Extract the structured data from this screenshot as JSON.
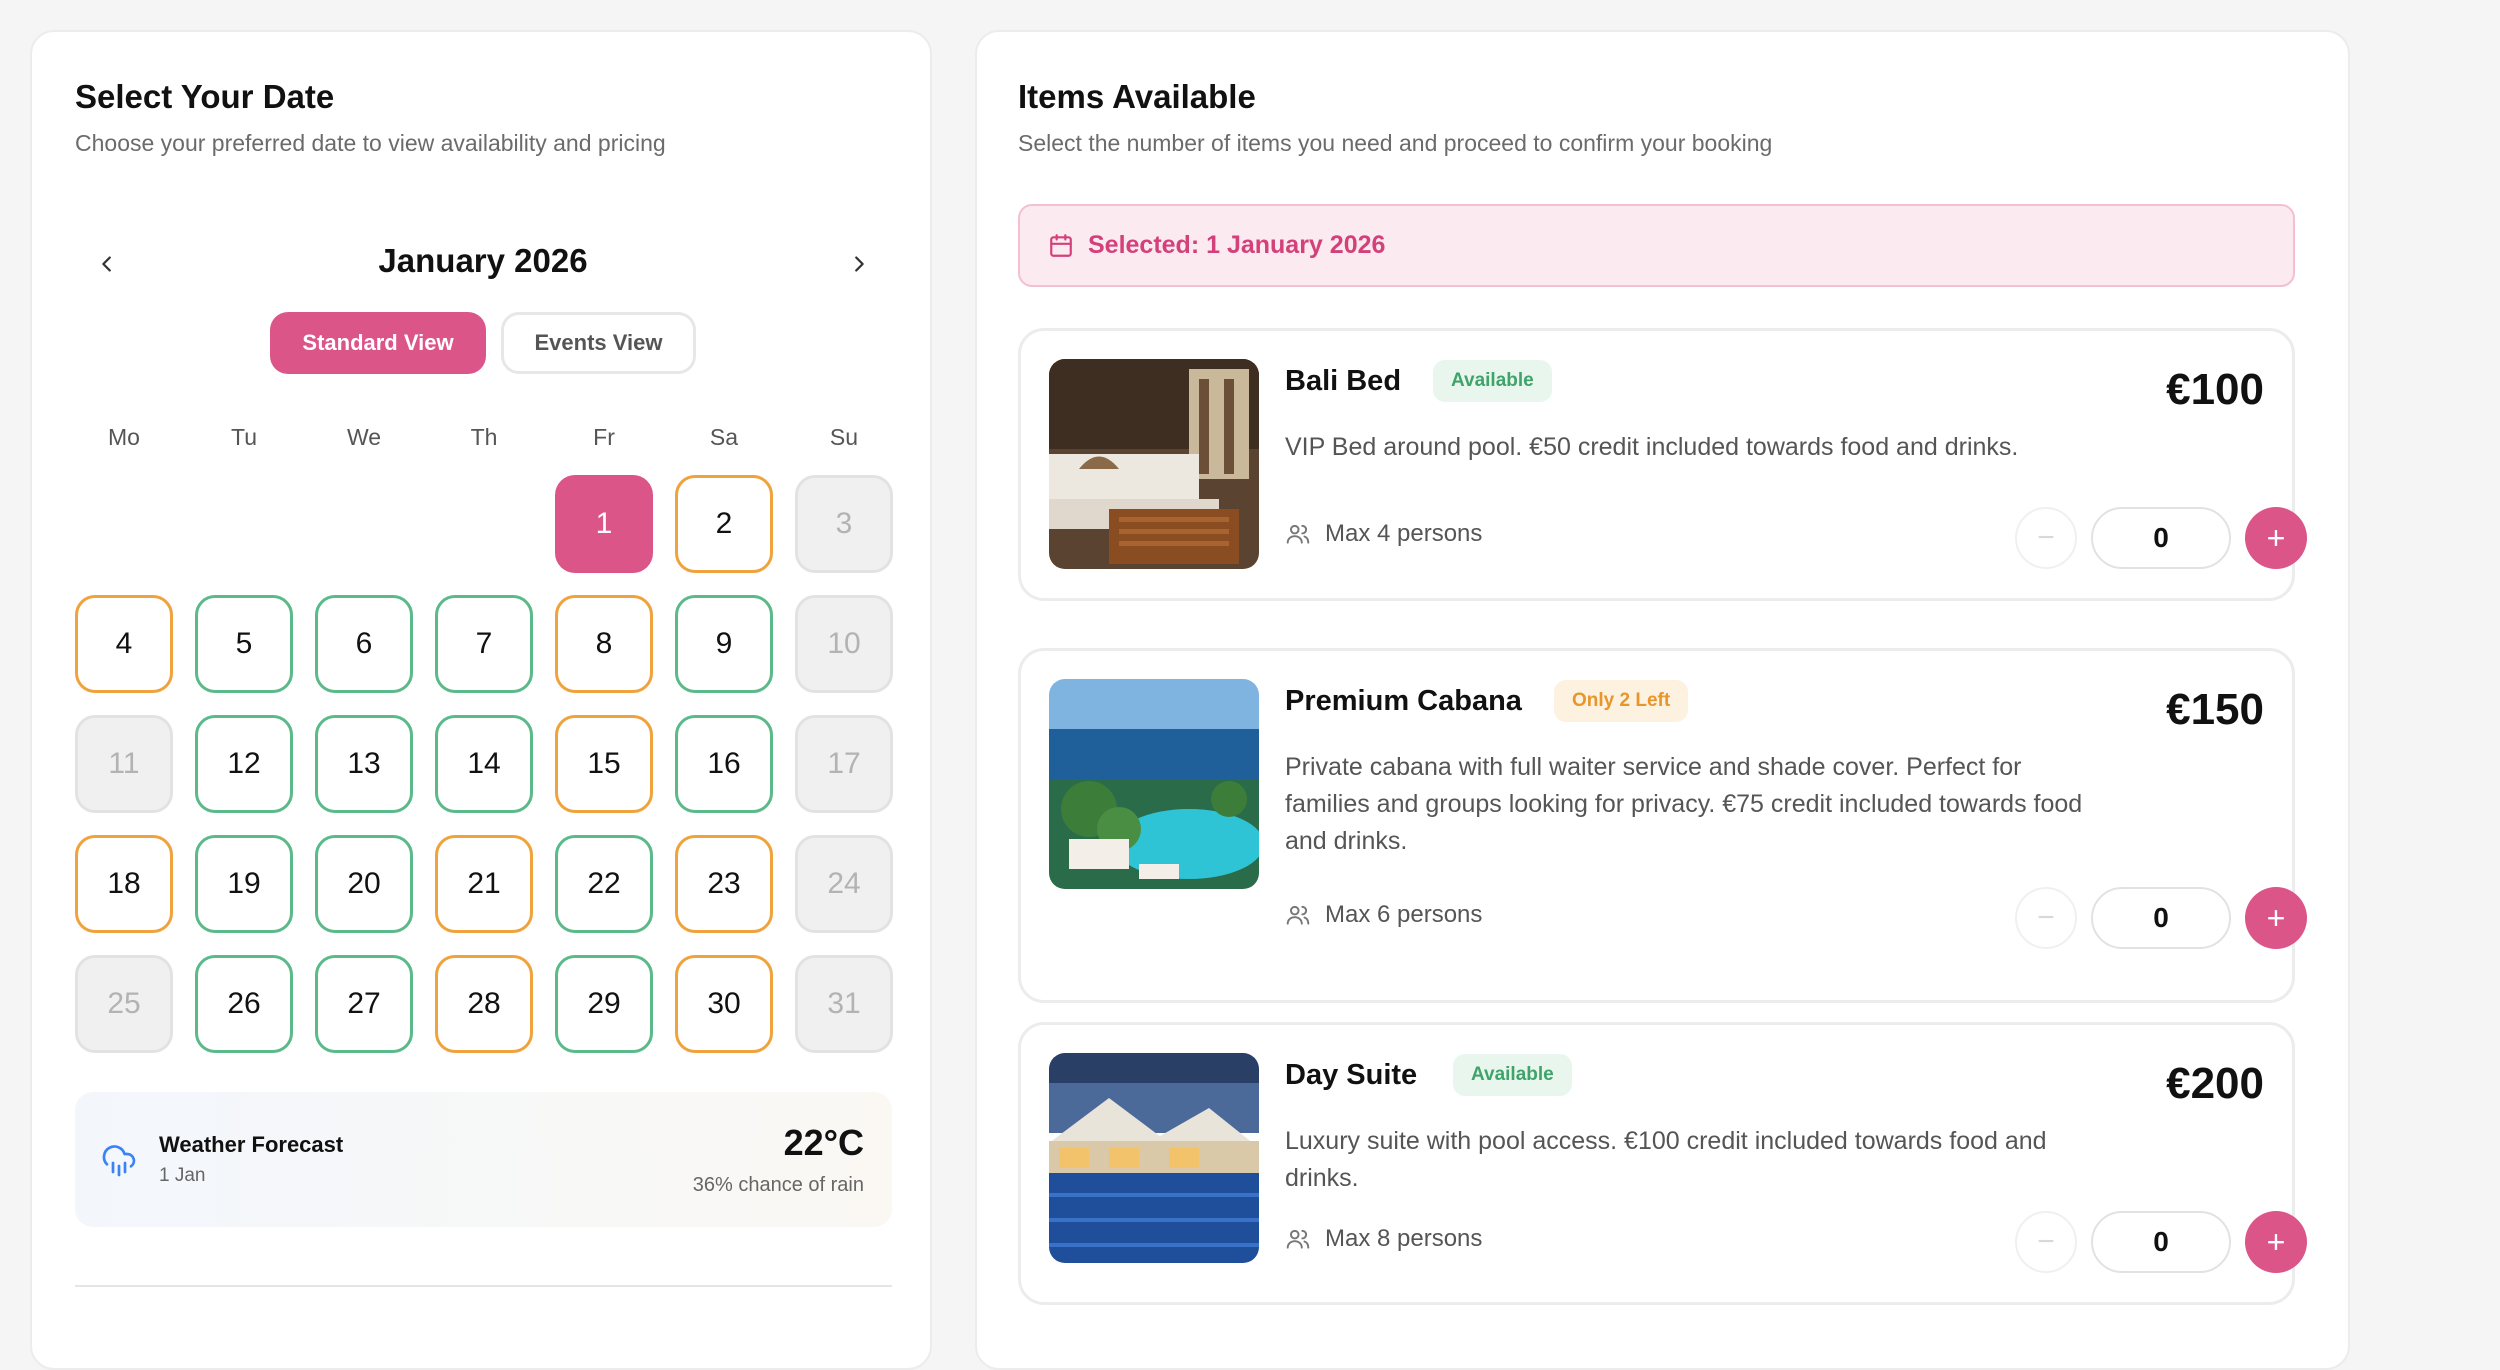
{
  "date_panel": {
    "title": "Select Your Date",
    "subtitle": "Choose your preferred date to view availability and pricing",
    "month_label": "January 2026",
    "view_toggle": {
      "standard": "Standard View",
      "events": "Events View",
      "active": "standard"
    },
    "weekdays": [
      "Mo",
      "Tu",
      "We",
      "Th",
      "Fr",
      "Sa",
      "Su"
    ],
    "days": [
      {
        "day": "1",
        "status": "selected"
      },
      {
        "day": "2",
        "status": "limited"
      },
      {
        "day": "3",
        "status": "unavailable"
      },
      {
        "day": "4",
        "status": "limited"
      },
      {
        "day": "5",
        "status": "available"
      },
      {
        "day": "6",
        "status": "available"
      },
      {
        "day": "7",
        "status": "available"
      },
      {
        "day": "8",
        "status": "limited"
      },
      {
        "day": "9",
        "status": "available"
      },
      {
        "day": "10",
        "status": "unavailable"
      },
      {
        "day": "11",
        "status": "unavailable"
      },
      {
        "day": "12",
        "status": "available"
      },
      {
        "day": "13",
        "status": "available"
      },
      {
        "day": "14",
        "status": "available"
      },
      {
        "day": "15",
        "status": "limited"
      },
      {
        "day": "16",
        "status": "available"
      },
      {
        "day": "17",
        "status": "unavailable"
      },
      {
        "day": "18",
        "status": "limited"
      },
      {
        "day": "19",
        "status": "available"
      },
      {
        "day": "20",
        "status": "available"
      },
      {
        "day": "21",
        "status": "limited"
      },
      {
        "day": "22",
        "status": "available"
      },
      {
        "day": "23",
        "status": "limited"
      },
      {
        "day": "24",
        "status": "unavailable"
      },
      {
        "day": "25",
        "status": "unavailable"
      },
      {
        "day": "26",
        "status": "available"
      },
      {
        "day": "27",
        "status": "available"
      },
      {
        "day": "28",
        "status": "limited"
      },
      {
        "day": "29",
        "status": "available"
      },
      {
        "day": "30",
        "status": "limited"
      },
      {
        "day": "31",
        "status": "unavailable"
      }
    ],
    "weather": {
      "title": "Weather Forecast",
      "date": "1 Jan",
      "temperature": "22°C",
      "rain": "36% chance of rain",
      "icon": "cloud-rain-icon"
    }
  },
  "items_panel": {
    "title": "Items Available",
    "subtitle": "Select the number of items you need and proceed to confirm your booking",
    "selected_label": "Selected: 1 January 2026",
    "items": [
      {
        "name": "Bali Bed",
        "badge": "Available",
        "badge_type": "available",
        "price": "€100",
        "description": "VIP Bed around pool. €50 credit included towards food and drinks.",
        "max": "Max 4 persons",
        "quantity": "0"
      },
      {
        "name": "Premium Cabana",
        "badge": "Only 2 Left",
        "badge_type": "limited",
        "price": "€150",
        "description": "Private cabana with full waiter service and shade cover. Perfect for families and groups looking for privacy. €75 credit included towards food and drinks.",
        "max": "Max 6 persons",
        "quantity": "0"
      },
      {
        "name": "Day Suite",
        "badge": "Available",
        "badge_type": "available",
        "price": "€200",
        "description": "Luxury suite with pool access. €100 credit included towards food and drinks.",
        "max": "Max 8 persons",
        "quantity": "0"
      }
    ]
  },
  "colors": {
    "accent": "#dc5588",
    "available": "#5cb98a",
    "limited": "#f0a23c",
    "unavailable": "#e2e2e2"
  }
}
